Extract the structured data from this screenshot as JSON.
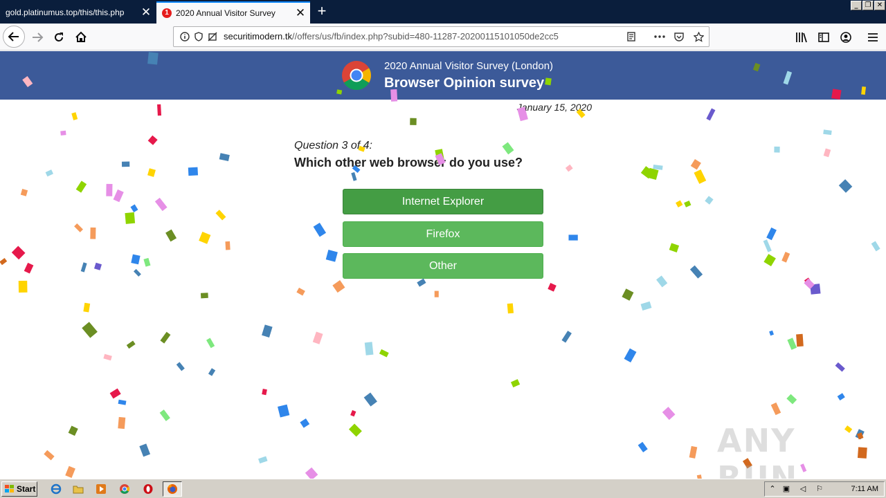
{
  "browser": {
    "tabs": [
      {
        "title": "gold.platinumus.top/this/this.php",
        "active": false
      },
      {
        "title": "2020 Annual Visitor Survey",
        "favicon_badge": "1",
        "active": true
      }
    ],
    "url": {
      "host": "securitimodern.tk",
      "path": "//offers/us/fb/index.php?subid=480-11287-20200115101050de2cc5"
    }
  },
  "page": {
    "banner": {
      "subtitle": "2020 Annual Visitor Survey (London)",
      "title": "Browser Opinion survey",
      "background": "#3c5a99"
    },
    "date": "January 15, 2020",
    "question_counter": "Question 3 of 4:",
    "question": "Which other web browser do you use?",
    "answers": [
      "Internet Explorer",
      "Firefox",
      "Other"
    ],
    "answer_color": "#5cb85c"
  },
  "watermark": "ANY RUN",
  "taskbar": {
    "start_label": "Start",
    "clock": "7:11 AM",
    "quick_launch": [
      "internet-explorer-icon",
      "folder-icon",
      "media-player-icon",
      "chrome-icon",
      "opera-icon",
      "firefox-icon"
    ]
  }
}
